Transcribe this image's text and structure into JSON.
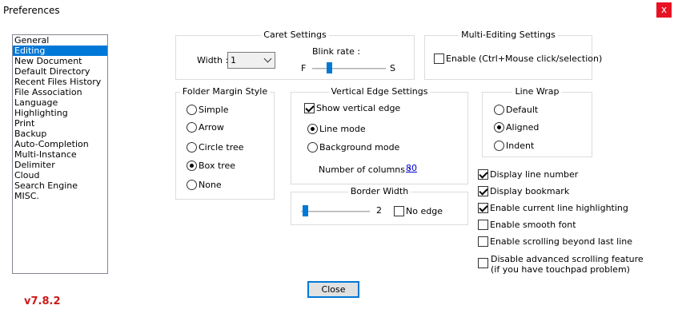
{
  "window": {
    "title": "Preferences",
    "close_glyph": "x"
  },
  "sidebar": {
    "items": [
      {
        "label": "General"
      },
      {
        "label": "Editing",
        "selected": true
      },
      {
        "label": "New Document"
      },
      {
        "label": "Default Directory"
      },
      {
        "label": "Recent Files History"
      },
      {
        "label": "File Association"
      },
      {
        "label": "Language"
      },
      {
        "label": "Highlighting"
      },
      {
        "label": "Print"
      },
      {
        "label": "Backup"
      },
      {
        "label": "Auto-Completion"
      },
      {
        "label": "Multi-Instance"
      },
      {
        "label": "Delimiter"
      },
      {
        "label": "Cloud"
      },
      {
        "label": "Search Engine"
      },
      {
        "label": "MISC."
      }
    ]
  },
  "caret": {
    "title": "Caret Settings",
    "width_label": "Width :",
    "width_value": "1",
    "blink_label": "Blink rate :",
    "blink_fast": "F",
    "blink_slow": "S"
  },
  "multi_edit": {
    "title": "Multi-Editing Settings",
    "enable_label": "Enable (Ctrl+Mouse click/selection)",
    "enabled": false
  },
  "folder_margin": {
    "title": "Folder Margin Style",
    "options": [
      "Simple",
      "Arrow",
      "Circle tree",
      "Box tree",
      "None"
    ],
    "selected": "Box tree"
  },
  "vertical_edge": {
    "title": "Vertical Edge Settings",
    "show_label": "Show vertical edge",
    "show": true,
    "line_mode": "Line mode",
    "background_mode": "Background mode",
    "mode": "Line mode",
    "columns_label": "Number of columns :",
    "columns_value": "80"
  },
  "line_wrap": {
    "title": "Line Wrap",
    "options": [
      "Default",
      "Aligned",
      "Indent"
    ],
    "selected": "Aligned"
  },
  "border_width": {
    "title": "Border Width",
    "value": "2",
    "no_edge_label": "No edge",
    "no_edge": false
  },
  "checkboxes": [
    {
      "label": "Display line number",
      "checked": true
    },
    {
      "label": "Display bookmark",
      "checked": true
    },
    {
      "label": "Enable current line highlighting",
      "checked": true
    },
    {
      "label": "Enable smooth font",
      "checked": false
    },
    {
      "label": "Enable scrolling beyond last line",
      "checked": false
    }
  ],
  "advanced_scroll": {
    "line1": "Disable advanced scrolling feature",
    "line2": "(if you have touchpad problem)",
    "checked": false
  },
  "close_button": "Close",
  "version": "v7.8.2",
  "colors": {
    "selection": "#0078d7",
    "version": "#cc1a1a",
    "close_bg": "#e81123"
  }
}
